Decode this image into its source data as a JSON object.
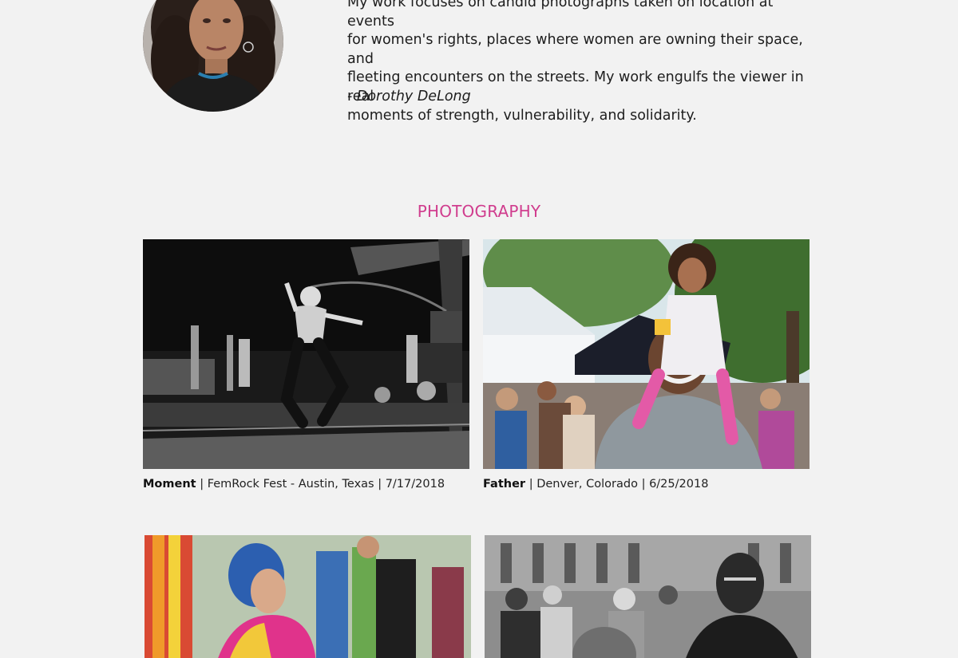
{
  "bio": {
    "lines": [
      "My work focuses on candid photographs taken on location at events",
      "for women's rights, places where women are owning their space, and",
      "fleeting encounters on the streets. My work engulfs the viewer in real",
      "moments of strength, vulnerability, and solidarity."
    ],
    "signature": "- Dorothy DeLong"
  },
  "section": {
    "heading": "PHOTOGRAPHY"
  },
  "photos": [
    {
      "title": "Moment",
      "details": " | FemRock Fest - Austin, Texas | 7/17/2018"
    },
    {
      "title": "Father",
      "details": " | Denver, Colorado | 6/25/2018"
    }
  ],
  "colors": {
    "background": "#f2f2f2",
    "accent": "#d03d8e",
    "text": "#1d1d1d"
  }
}
